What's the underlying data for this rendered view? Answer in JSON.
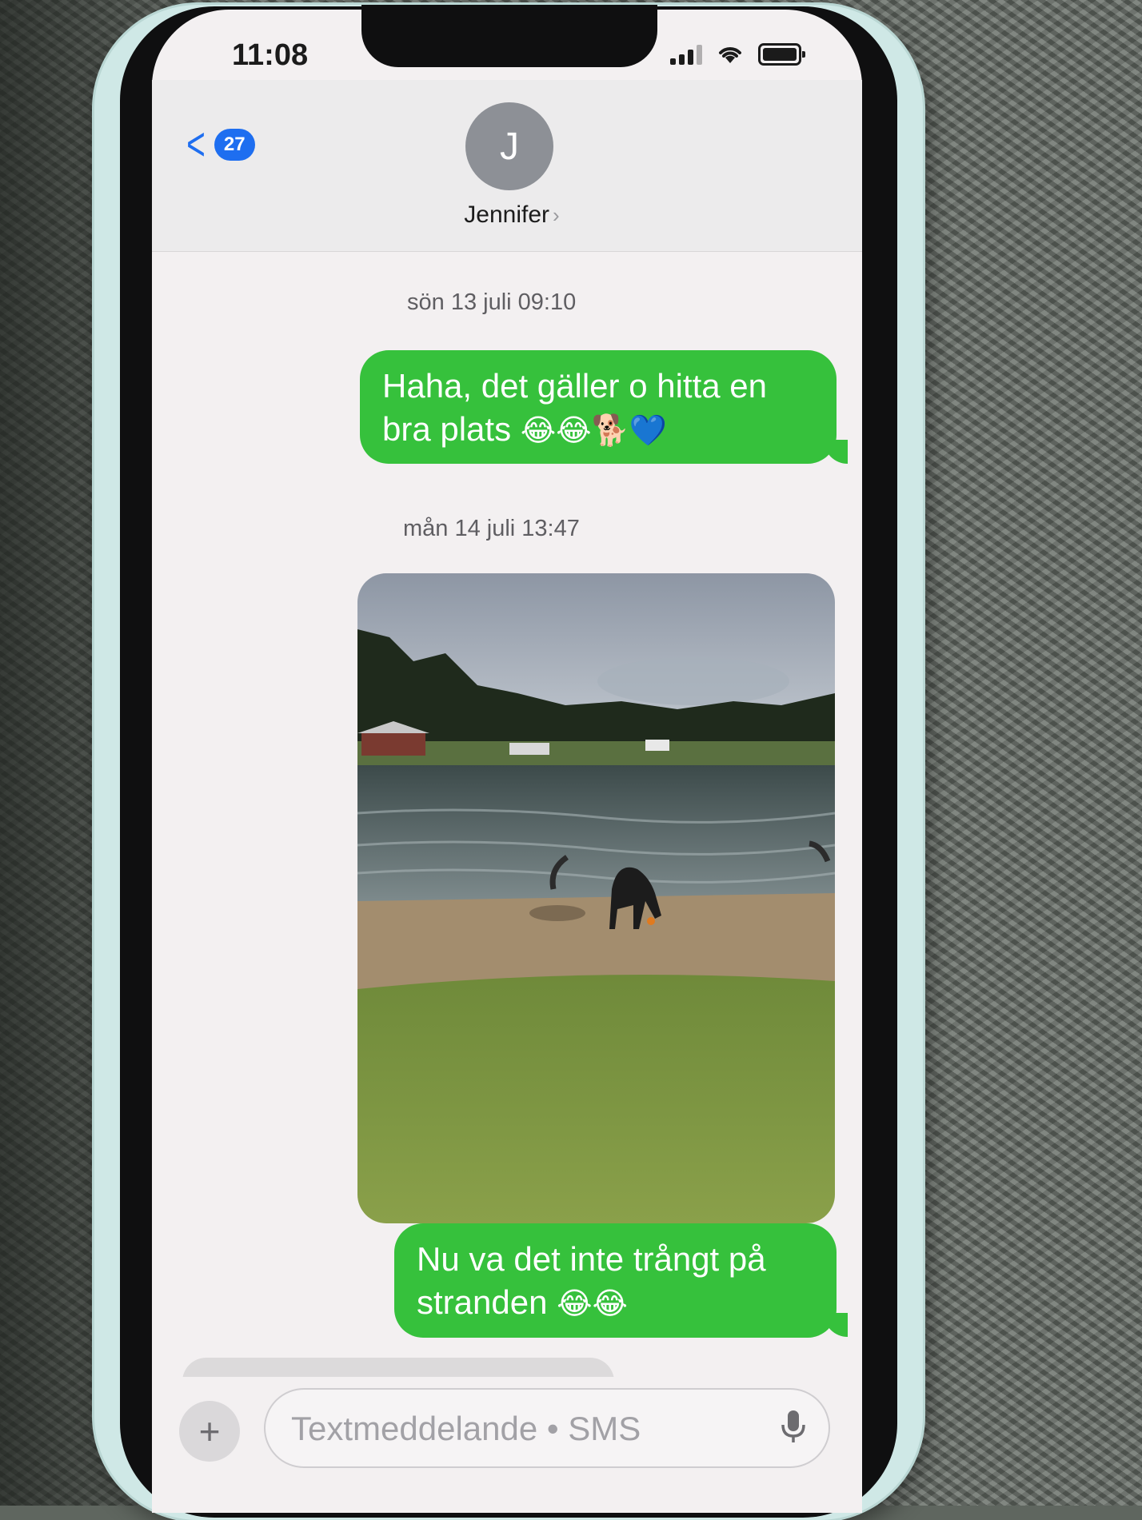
{
  "status_bar": {
    "time": "11:08"
  },
  "header": {
    "back_count": "27",
    "avatar_initial": "J",
    "contact_name": "Jennifer"
  },
  "messages": [
    {
      "timestamp": "sön 13 juli 09:10",
      "text_line1": "Haha, det gäller o hitta en",
      "text_line2": "bra plats",
      "emoji": "😂😂🐕💙"
    },
    {
      "timestamp": "mån 14 juli 13:47",
      "photo": "photo-attachment"
    },
    {
      "text_line1": "Nu va det inte trångt på",
      "text_line2": "stranden",
      "emoji": "😂😂"
    }
  ],
  "input": {
    "placeholder": "Textmeddelande • SMS",
    "plus_label": "+"
  },
  "colors": {
    "sent_bubble": "#36c13c",
    "link_blue": "#1e6ef0",
    "avatar_gray": "#8d9096",
    "phone_case": "#cfe8e6"
  }
}
